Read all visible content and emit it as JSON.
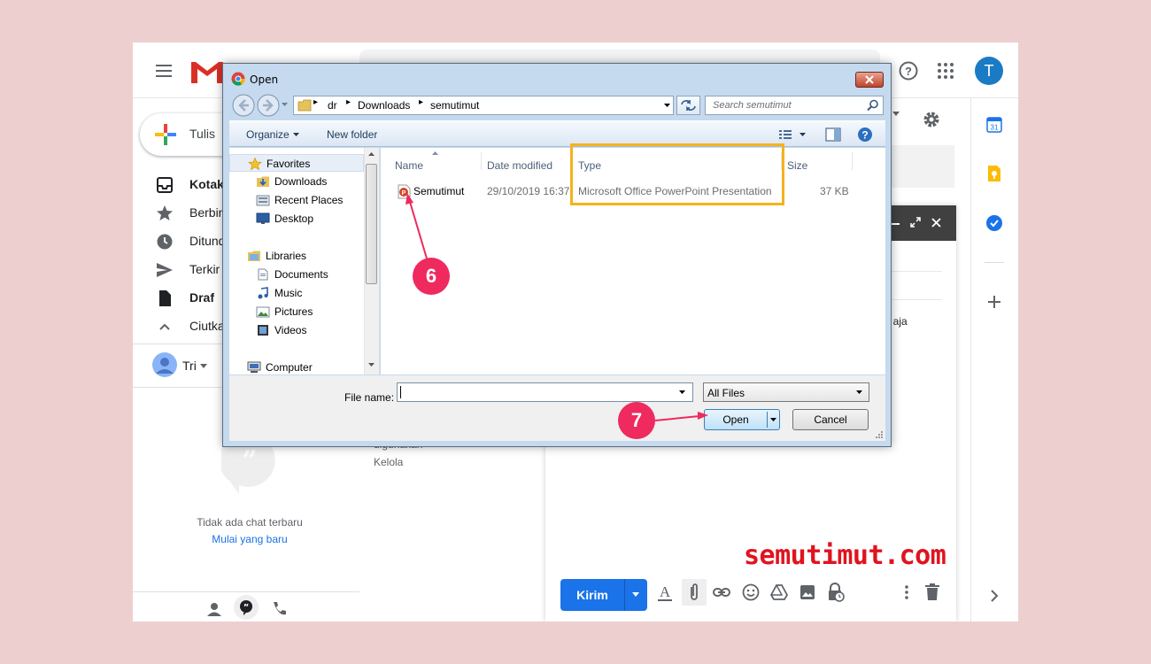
{
  "gmail": {
    "compose_label": "Tulis",
    "nav": [
      {
        "label": "Kotak",
        "bold": true
      },
      {
        "label": "Berbin",
        "bold": false
      },
      {
        "label": "Ditund",
        "bold": false
      },
      {
        "label": "Terkir",
        "bold": false
      },
      {
        "label": "Draf",
        "bold": true
      },
      {
        "label": "Ciutka",
        "bold": false
      }
    ],
    "user_label": "Tri",
    "avatar_letter": "T",
    "calendar_day": "31",
    "chat_empty": "Tidak ada chat terbaru",
    "chat_start": "Mulai yang baru",
    "footer_text_partial": "digunakan",
    "footer_manage": "Kelola",
    "compose_body_partial": "il aja",
    "send_label": "Kirim"
  },
  "watermark": "semutimut.com",
  "dialog": {
    "title": "Open",
    "breadcrumb": [
      "dr",
      "Downloads",
      "semutimut"
    ],
    "search_placeholder": "Search semutimut",
    "toolbar": {
      "organize": "Organize",
      "new_folder": "New folder"
    },
    "nav_pane": [
      {
        "label": "Favorites",
        "icon": "star-icon",
        "header": true
      },
      {
        "label": "Downloads",
        "icon": "downloads-folder-icon",
        "header": false
      },
      {
        "label": "Recent Places",
        "icon": "recent-places-icon",
        "header": false
      },
      {
        "label": "Desktop",
        "icon": "desktop-icon",
        "header": false
      },
      {
        "label": "Libraries",
        "icon": "libraries-icon",
        "header": true
      },
      {
        "label": "Documents",
        "icon": "documents-icon",
        "header": false
      },
      {
        "label": "Music",
        "icon": "music-icon",
        "header": false
      },
      {
        "label": "Pictures",
        "icon": "pictures-icon",
        "header": false
      },
      {
        "label": "Videos",
        "icon": "videos-icon",
        "header": false
      },
      {
        "label": "Computer",
        "icon": "computer-icon",
        "header": true
      }
    ],
    "columns": [
      "Name",
      "Date modified",
      "Type",
      "Size"
    ],
    "files": [
      {
        "name": "Semutimut",
        "date": "29/10/2019 16:37",
        "type": "Microsoft Office PowerPoint Presentation",
        "size": "37 KB"
      }
    ],
    "file_name_label": "File name:",
    "file_name_value": "",
    "filter": "All Files",
    "open_label": "Open",
    "cancel_label": "Cancel"
  },
  "annotations": {
    "step6": "6",
    "step7": "7",
    "accent": "#ee2a5f",
    "highlight": "#f5b21b"
  }
}
